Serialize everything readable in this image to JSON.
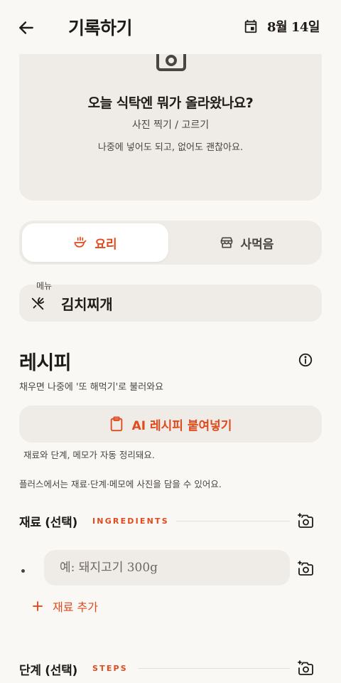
{
  "header": {
    "title": "기록하기",
    "date": "8월 14일"
  },
  "photo": {
    "title": "오늘 식탁엔 뭐가 올라왔나요?",
    "subtitle": "사진 찍기 / 고르기",
    "hint": "나중에 넣어도 되고, 없어도 괜찮아요."
  },
  "mode_toggle": {
    "options": [
      {
        "label": "요리",
        "icon": "cooking-icon",
        "active": true
      },
      {
        "label": "사먹음",
        "icon": "store-icon",
        "active": false
      }
    ]
  },
  "menu": {
    "label": "메뉴",
    "value": "김치찌개",
    "icon": "utensils-icon"
  },
  "recipe": {
    "title": "레시피",
    "subtitle": "채우면 나중에 '또 해먹기'로 불러와요",
    "ai_button": "AI 레시피 붙여넣기",
    "note_auto": "재료와 단계, 메모가 자동 정리돼요.",
    "note_plus": "플러스에서는 재료·단계·메모에 사진을 담을 수 있어요."
  },
  "ingredients": {
    "title": "재료 (선택)",
    "tag": "INGREDIENTS",
    "placeholder": "예: 돼지고기 300g",
    "add_label": "재료 추가"
  },
  "steps": {
    "title": "단계 (선택)",
    "tag": "STEPS"
  },
  "colors": {
    "accent": "#E04A1C",
    "background": "#FAF8F5",
    "card": "#EFEBE6",
    "text": "#1E1B18",
    "muted": "#4A4540"
  }
}
